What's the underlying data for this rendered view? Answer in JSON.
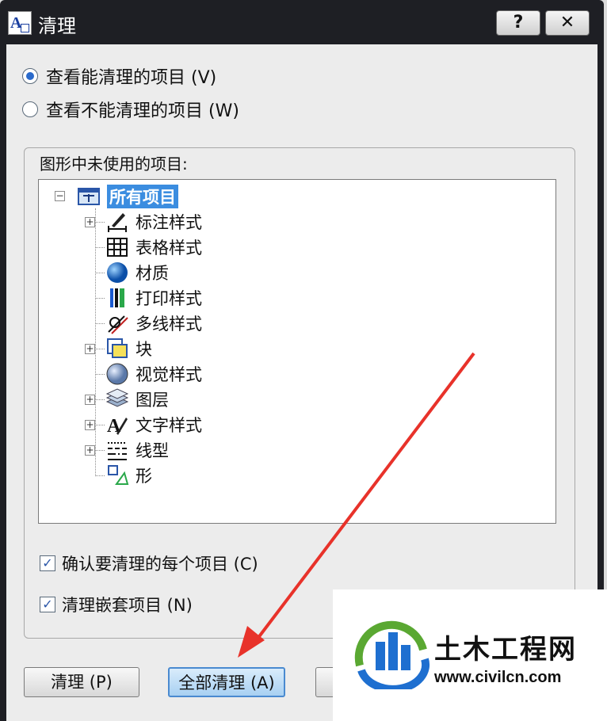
{
  "window": {
    "title": "清理",
    "help_label": "?",
    "close_label": "✕"
  },
  "options": {
    "view_purgeable": "查看能清理的项目 (V)",
    "view_unpurgeable": "查看不能清理的项目 (W)",
    "selected": "view_purgeable"
  },
  "tree": {
    "group_label": "图形中未使用的项目:",
    "root": "所有项目",
    "items": [
      {
        "label": "标注样式",
        "icon": "dimension-style-icon",
        "expandable": true
      },
      {
        "label": "表格样式",
        "icon": "table-style-icon",
        "expandable": false
      },
      {
        "label": "材质",
        "icon": "material-sphere-icon",
        "expandable": false
      },
      {
        "label": "打印样式",
        "icon": "plot-style-icon",
        "expandable": false
      },
      {
        "label": "多线样式",
        "icon": "multiline-style-icon",
        "expandable": false
      },
      {
        "label": "块",
        "icon": "block-icon",
        "expandable": true
      },
      {
        "label": "视觉样式",
        "icon": "visual-style-icon",
        "expandable": false
      },
      {
        "label": "图层",
        "icon": "layers-icon",
        "expandable": true
      },
      {
        "label": "文字样式",
        "icon": "text-style-icon",
        "expandable": true
      },
      {
        "label": "线型",
        "icon": "linetype-icon",
        "expandable": true
      },
      {
        "label": "形",
        "icon": "shape-icon",
        "expandable": false
      }
    ]
  },
  "checkboxes": {
    "confirm_each": "确认要清理的每个项目 (C)",
    "purge_nested": "清理嵌套项目 (N)"
  },
  "buttons": {
    "purge": "清理 (P)",
    "purge_all": "全部清理 (A)"
  },
  "watermark": {
    "name": "土木工程网",
    "url": "www.civilcn.com"
  },
  "colors": {
    "titlebar": "#1e1f24",
    "selection": "#3b8de0",
    "arrow": "#e8322a"
  }
}
